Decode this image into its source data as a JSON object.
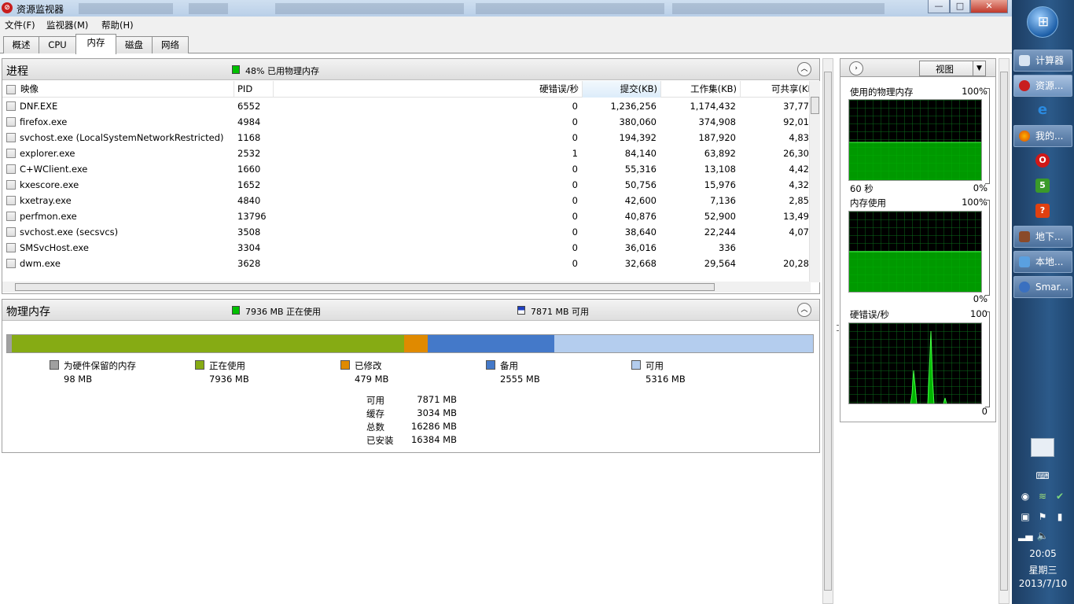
{
  "window": {
    "title": "资源监视器",
    "title_icon": "resource-monitor-icon",
    "min": "—",
    "max": "□",
    "close": "✕"
  },
  "menubar": {
    "file": "文件(F)",
    "monitor": "监视器(M)",
    "help": "帮助(H)"
  },
  "tabs": {
    "overview": "概述",
    "cpu": "CPU",
    "memory": "内存",
    "disk": "磁盘",
    "network": "网络",
    "active": "内存"
  },
  "processes": {
    "title": "进程",
    "summary": "48% 已用物理内存",
    "summary_color": "#00c000",
    "columns": {
      "image": "映像",
      "pid": "PID",
      "hard_faults": "硬错误/秒",
      "commit": "提交(KB)",
      "working_set": "工作集(KB)",
      "shareable": "可共享(KB"
    },
    "rows": [
      {
        "image": "DNF.EXE",
        "pid": "6552",
        "hard_faults": "0",
        "commit": "1,236,256",
        "working_set": "1,174,432",
        "shareable": "37,77"
      },
      {
        "image": "firefox.exe",
        "pid": "4984",
        "hard_faults": "0",
        "commit": "380,060",
        "working_set": "374,908",
        "shareable": "92,01"
      },
      {
        "image": "svchost.exe (LocalSystemNetworkRestricted)",
        "pid": "1168",
        "hard_faults": "0",
        "commit": "194,392",
        "working_set": "187,920",
        "shareable": "4,83"
      },
      {
        "image": "explorer.exe",
        "pid": "2532",
        "hard_faults": "1",
        "commit": "84,140",
        "working_set": "63,892",
        "shareable": "26,30"
      },
      {
        "image": "C+WClient.exe",
        "pid": "1660",
        "hard_faults": "0",
        "commit": "55,316",
        "working_set": "13,108",
        "shareable": "4,42"
      },
      {
        "image": "kxescore.exe",
        "pid": "1652",
        "hard_faults": "0",
        "commit": "50,756",
        "working_set": "15,976",
        "shareable": "4,32"
      },
      {
        "image": "kxetray.exe",
        "pid": "4840",
        "hard_faults": "0",
        "commit": "42,600",
        "working_set": "7,136",
        "shareable": "2,85"
      },
      {
        "image": "perfmon.exe",
        "pid": "13796",
        "hard_faults": "0",
        "commit": "40,876",
        "working_set": "52,900",
        "shareable": "13,49"
      },
      {
        "image": "svchost.exe (secsvcs)",
        "pid": "3508",
        "hard_faults": "0",
        "commit": "38,640",
        "working_set": "22,244",
        "shareable": "4,07"
      },
      {
        "image": "SMSvcHost.exe",
        "pid": "3304",
        "hard_faults": "0",
        "commit": "36,016",
        "working_set": "336",
        "shareable": ""
      },
      {
        "image": "dwm.exe",
        "pid": "3628",
        "hard_faults": "0",
        "commit": "32,668",
        "working_set": "29,564",
        "shareable": "20,28"
      }
    ]
  },
  "physical": {
    "title": "物理内存",
    "in_use_summary": "7936 MB 正在使用",
    "available_summary": "7871 MB 可用",
    "bar_fractions": {
      "reserved": 0.006,
      "in_use": 0.487,
      "modified": 0.029,
      "standby": 0.157,
      "free": 0.321
    },
    "legend": [
      {
        "label": "为硬件保留的内存",
        "value": "98 MB",
        "color": "#a0a0a0"
      },
      {
        "label": "正在使用",
        "value": "7936 MB",
        "color": "#86ab14"
      },
      {
        "label": "已修改",
        "value": "479 MB",
        "color": "#e08a00"
      },
      {
        "label": "备用",
        "value": "2555 MB",
        "color": "#4479c9"
      },
      {
        "label": "可用",
        "value": "5316 MB",
        "color": "#b4cdee"
      }
    ],
    "stats": [
      {
        "k": "可用",
        "v": "7871 MB"
      },
      {
        "k": "缓存",
        "v": "3034 MB"
      },
      {
        "k": "总数",
        "v": "16286 MB"
      },
      {
        "k": "已安装",
        "v": "16384 MB"
      }
    ]
  },
  "graphs": {
    "view_label": "视图",
    "g1": {
      "title": "使用的物理内存",
      "max": "100%",
      "left": "60 秒",
      "min": "0%",
      "level": 0.48
    },
    "g2": {
      "title": "内存使用",
      "max": "100%",
      "min": "0%",
      "level": 0.51
    },
    "g3": {
      "title": "硬错误/秒",
      "max": "100",
      "min": "0"
    }
  },
  "taskbar": {
    "items": [
      {
        "label": "计算器",
        "icon": "calculator-icon"
      },
      {
        "label": "资源...",
        "icon": "resource-monitor-icon"
      },
      {
        "label": "我的...",
        "icon": "firefox-icon"
      },
      {
        "label": "地下...",
        "icon": "game-icon"
      },
      {
        "label": "本地...",
        "icon": "network-icon"
      },
      {
        "label": "Smar...",
        "icon": "app-icon"
      }
    ],
    "time": "20:05",
    "weekday": "星期三",
    "date": "2013/7/10"
  }
}
